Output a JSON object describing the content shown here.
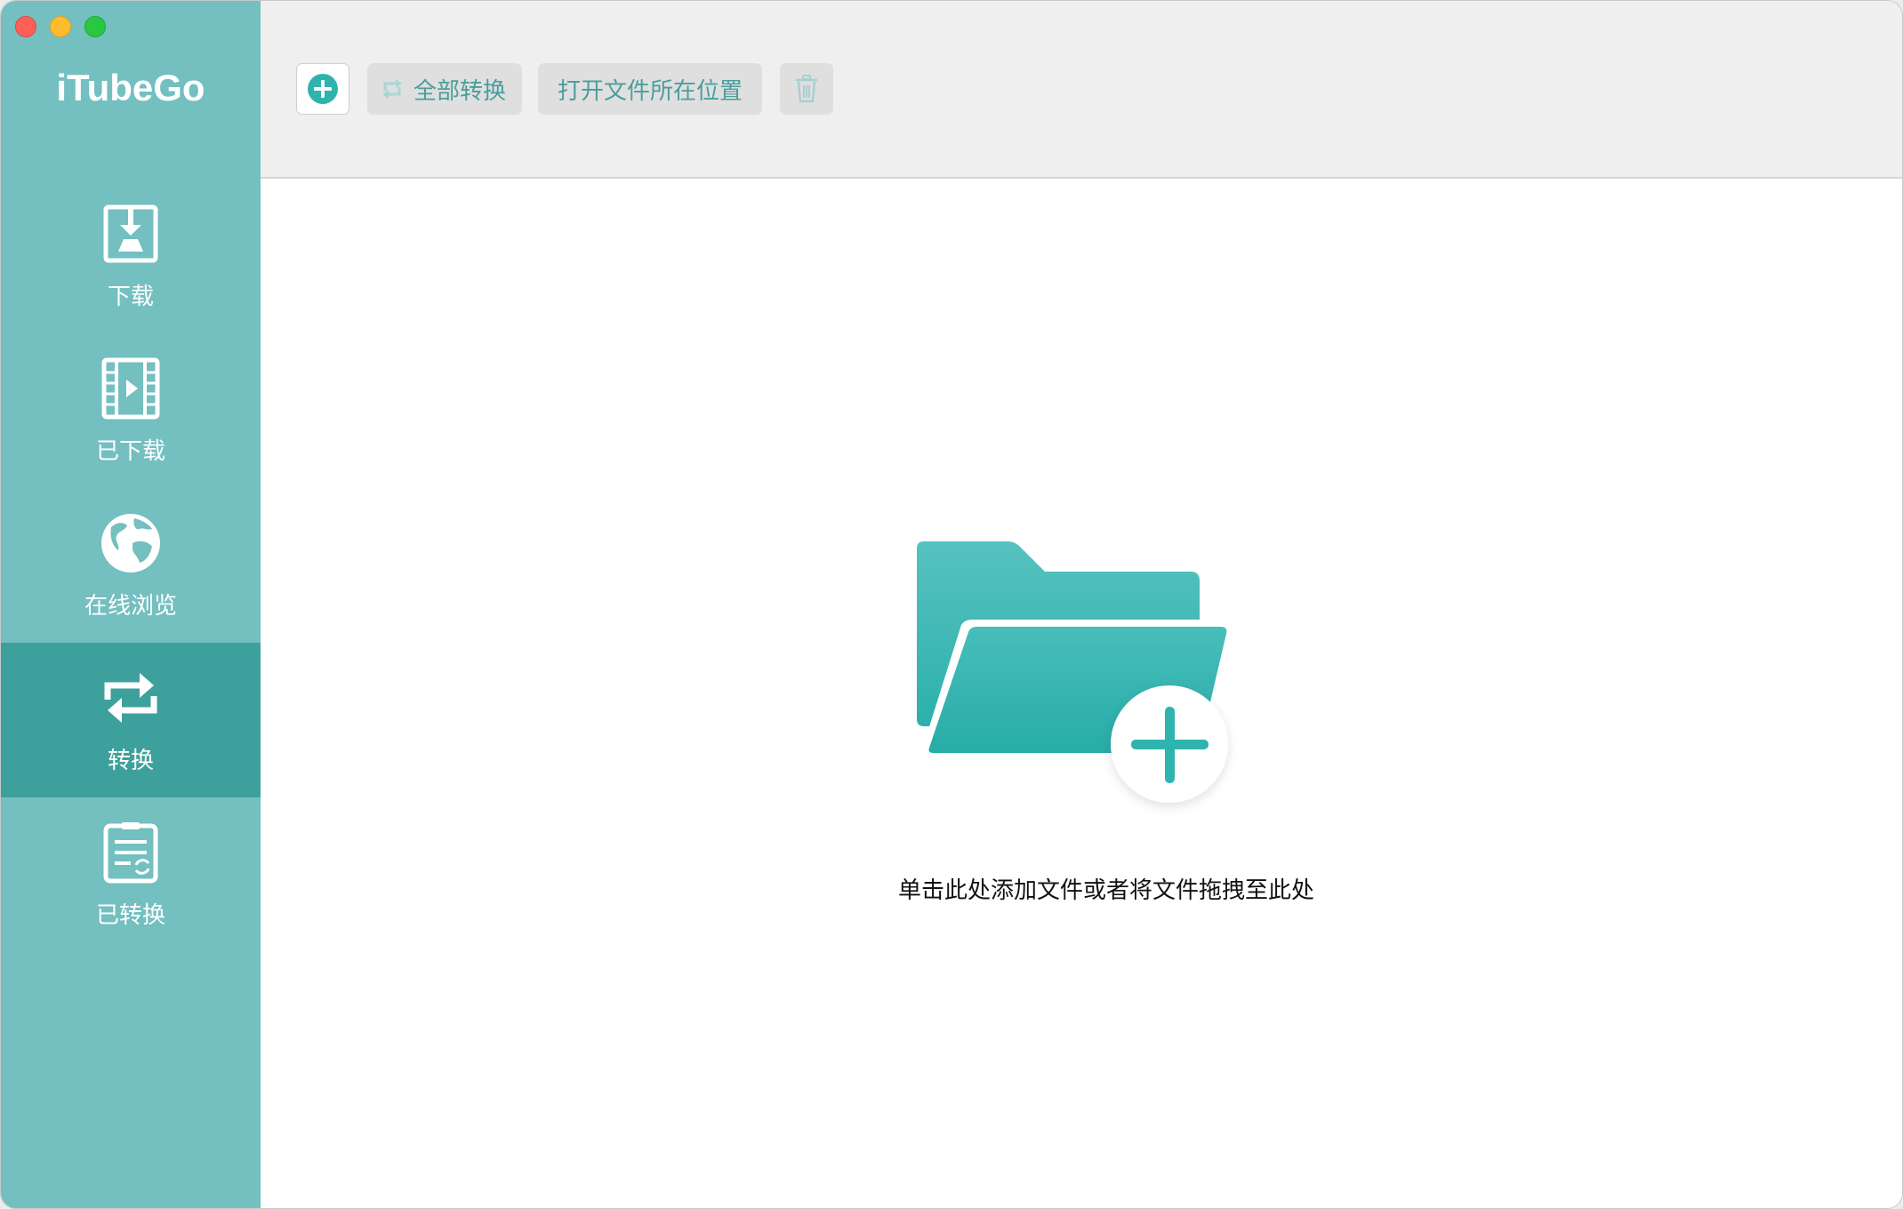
{
  "window": {
    "traffic_lights": [
      "close",
      "minimize",
      "maximize"
    ]
  },
  "app": {
    "name": "iTubeGo"
  },
  "sidebar": {
    "items": [
      {
        "label": "下载",
        "icon": "download-icon",
        "active": false
      },
      {
        "label": "已下载",
        "icon": "film-icon",
        "active": false
      },
      {
        "label": "在线浏览",
        "icon": "globe-icon",
        "active": false
      },
      {
        "label": "转换",
        "icon": "convert-icon",
        "active": true
      },
      {
        "label": "已转换",
        "icon": "converted-list-icon",
        "active": false
      }
    ]
  },
  "toolbar": {
    "add_icon": "plus-circle-icon",
    "convert_all_label": "全部转换",
    "convert_all_icon": "refresh-icon",
    "open_location_label": "打开文件所在位置",
    "trash_icon": "trash-icon"
  },
  "main": {
    "drop_icon": "folder-add-icon",
    "drop_text": "单击此处添加文件或者将文件拖拽至此处"
  },
  "colors": {
    "sidebar_bg": "#74bfc0",
    "sidebar_active": "#3ea09c",
    "accent": "#3bb5b3",
    "toolbar_bg": "#efefef",
    "button_bg": "#dfdfdf",
    "button_text": "#4a9e9c"
  }
}
